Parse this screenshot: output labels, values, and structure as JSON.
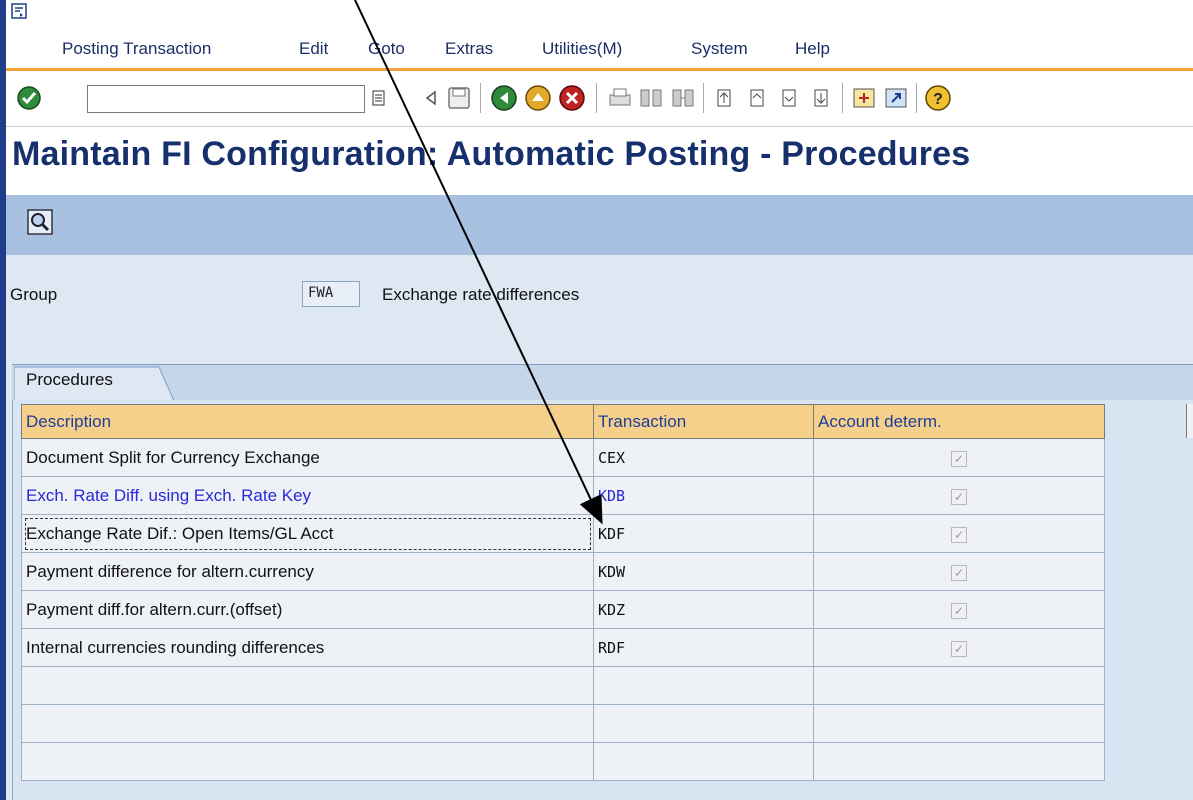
{
  "menu": {
    "items": [
      "Posting Transaction",
      "Edit",
      "Goto",
      "Extras",
      "Utilities(M)",
      "System",
      "Help"
    ]
  },
  "toolbar": {
    "command_field_value": "",
    "icons": [
      "enter-icon",
      "command-dropdown-icon",
      "back-arrow-icon",
      "save-icon",
      "back-icon",
      "exit-icon",
      "cancel-icon",
      "print-icon",
      "find-icon",
      "find-next-icon",
      "first-page-icon",
      "previous-page-icon",
      "next-page-icon",
      "last-page-icon",
      "create-session-icon",
      "shortcut-icon",
      "help-icon"
    ]
  },
  "page": {
    "title": "Maintain FI Configuration: Automatic Posting - Procedures"
  },
  "form": {
    "group_label": "Group",
    "group_value": "FWA",
    "group_description": "Exchange rate differences"
  },
  "tab": {
    "label": "Procedures"
  },
  "grid": {
    "headers": [
      "Description",
      "Transaction",
      "Account determ."
    ],
    "rows": [
      {
        "description": "Document Split for Currency Exchange",
        "transaction": "CEX",
        "account_determ": true
      },
      {
        "description": "Exch. Rate Diff. using Exch. Rate Key",
        "transaction": "KDB",
        "account_determ": true
      },
      {
        "description": "Exchange Rate Dif.: Open Items/GL Acct",
        "transaction": "KDF",
        "account_determ": true
      },
      {
        "description": "Payment difference for altern.currency",
        "transaction": "KDW",
        "account_determ": true
      },
      {
        "description": "Payment diff.for altern.curr.(offset)",
        "transaction": "KDZ",
        "account_determ": true
      },
      {
        "description": "Internal currencies rounding differences",
        "transaction": "RDF",
        "account_determ": true
      },
      {
        "description": "",
        "transaction": "",
        "account_determ": null
      },
      {
        "description": "",
        "transaction": "",
        "account_determ": null
      },
      {
        "description": "",
        "transaction": "",
        "account_determ": null
      }
    ]
  },
  "colors": {
    "title": "#16306d",
    "header_bg": "#f5d08a",
    "header_text": "#1f3e9a",
    "highlight_text": "#2a27d6",
    "accent_line": "#f0a23a"
  }
}
